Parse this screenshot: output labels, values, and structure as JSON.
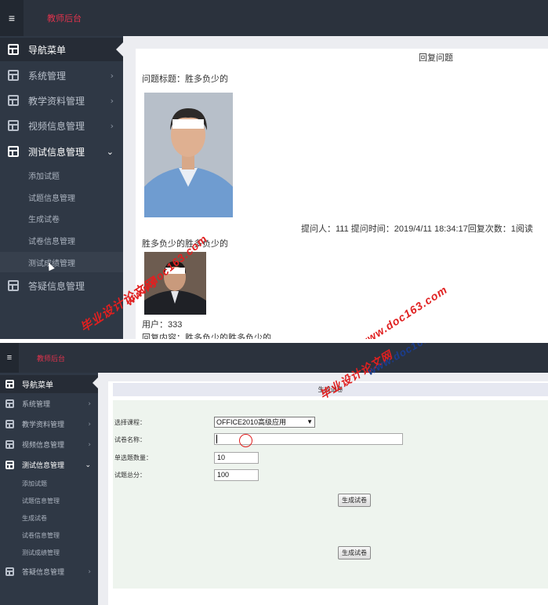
{
  "shot1": {
    "brand": "教师后台",
    "nav_header": "导航菜单",
    "nav": [
      {
        "label": "系统管理",
        "arrow": "›"
      },
      {
        "label": "教学资料管理",
        "arrow": "›"
      },
      {
        "label": "视频信息管理",
        "arrow": "›"
      },
      {
        "label": "测试信息管理",
        "arrow": "⌄"
      },
      {
        "label": "答疑信息管理",
        "arrow": ""
      }
    ],
    "sub": [
      "添加试题",
      "试题信息管理",
      "生成试卷",
      "试卷信息管理",
      "测试成绩管理"
    ],
    "page_title": "回复问题",
    "question_title": "问题标题：胜多负少的",
    "meta": "提问人：111 提问时间：2019/4/11 18:34:17回复次数：1阅读",
    "question_body": "胜多负少的胜多负少的",
    "user": "用户：333",
    "reply": "回复内容：胜多负少的胜多负少的"
  },
  "shot2": {
    "brand": "教师后台",
    "nav_header": "导航菜单",
    "nav": [
      {
        "label": "系统管理",
        "arrow": "›"
      },
      {
        "label": "教学资料管理",
        "arrow": "›"
      },
      {
        "label": "视频信息管理",
        "arrow": "›"
      },
      {
        "label": "测试信息管理",
        "arrow": "⌄"
      },
      {
        "label": "答疑信息管理",
        "arrow": "›"
      }
    ],
    "sub": [
      "添加试题",
      "试题信息管理",
      "生成试卷",
      "试卷信息管理",
      "测试成绩管理"
    ],
    "page_title": "生成试卷",
    "form": {
      "course_label": "选择课程：",
      "course_value": "OFFICE2010高级应用",
      "name_label": "试卷名称：",
      "name_value": "",
      "count_label": "单选题数量：",
      "count_value": "10",
      "total_label": "试题总分：",
      "total_value": "100",
      "submit_label": "生成试卷",
      "submit2_label": "生成试卷"
    }
  },
  "watermark": {
    "cn": "毕业设计论文网",
    "url": "www.doc163.com"
  }
}
